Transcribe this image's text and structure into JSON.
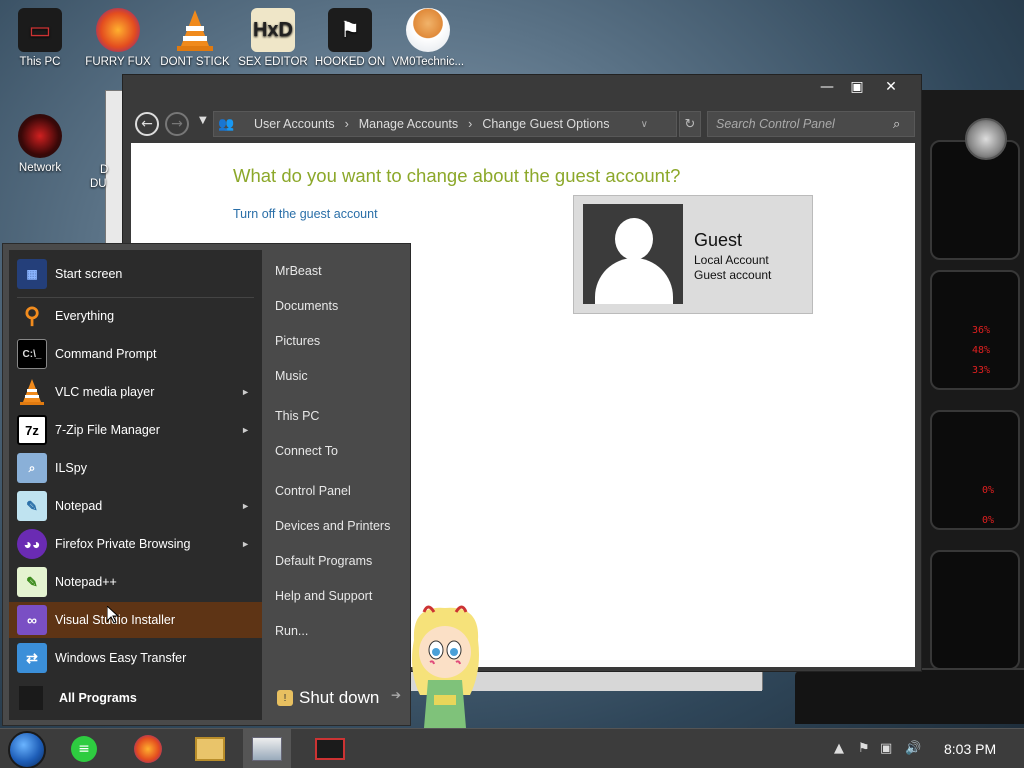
{
  "desktop": {
    "icons": [
      {
        "label": "This PC"
      },
      {
        "label": "FURRY FUX"
      },
      {
        "label": "DONT STICK"
      },
      {
        "label": "SEX EDITOR"
      },
      {
        "label": "HOOKED ON"
      },
      {
        "label": "VM0Technic..."
      },
      {
        "label": "Network"
      }
    ],
    "partial_labels": [
      "D",
      "DU"
    ]
  },
  "window": {
    "address": {
      "crumbs": [
        "User Accounts",
        "Manage Accounts",
        "Change Guest Options"
      ]
    },
    "search": {
      "placeholder": "Search Control Panel"
    },
    "headline": "What do you want to change about the guest account?",
    "turn_off_link": "Turn off the guest account",
    "account": {
      "name": "Guest",
      "line1": "Local Account",
      "line2": "Guest account"
    }
  },
  "start_menu": {
    "items": [
      {
        "label": "Start screen",
        "icon": "start-screen-icon"
      },
      {
        "label": "Everything",
        "icon": "search-magnifier-icon"
      },
      {
        "label": "Command Prompt",
        "icon": "terminal-icon"
      },
      {
        "label": "VLC media player",
        "icon": "traffic-cone-icon"
      },
      {
        "label": "7-Zip File Manager",
        "icon": "7zip-icon"
      },
      {
        "label": "ILSpy",
        "icon": "ilspy-icon"
      },
      {
        "label": "Notepad",
        "icon": "notepad-icon"
      },
      {
        "label": "Firefox Private Browsing",
        "icon": "private-mask-icon"
      },
      {
        "label": "Notepad++",
        "icon": "notepad-plus-icon"
      },
      {
        "label": "Visual Studio Installer",
        "icon": "visual-studio-icon"
      },
      {
        "label": "Windows Easy Transfer",
        "icon": "easy-transfer-icon"
      }
    ],
    "all_programs": "All Programs",
    "right": [
      "MrBeast",
      "Documents",
      "Pictures",
      "Music",
      "This PC",
      "Connect To",
      "Control Panel",
      "Devices and Printers",
      "Default Programs",
      "Help and Support",
      "Run..."
    ],
    "shutdown": "Shut down"
  },
  "taskbar": {
    "clock": "8:03 PM"
  },
  "colors": {
    "accent_green": "#8ca82a",
    "link_blue": "#2a6fa8",
    "highlight": "#5e3415",
    "widget_red": "#e02020"
  }
}
